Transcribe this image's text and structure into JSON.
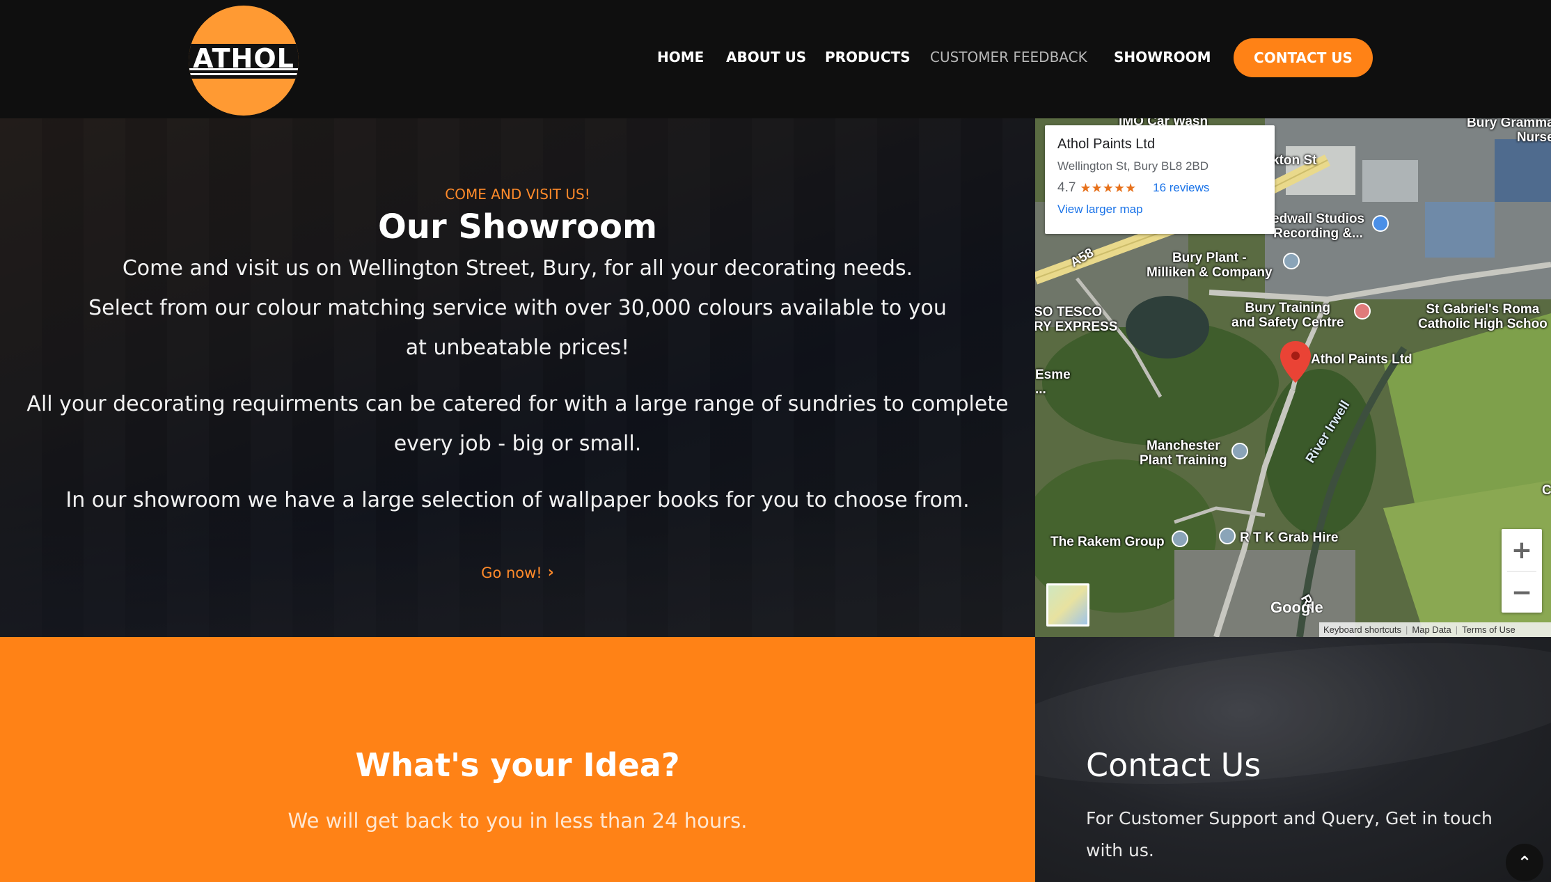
{
  "header": {
    "logo_text": "ATHOL",
    "nav": [
      {
        "label": "HOME"
      },
      {
        "label": "ABOUT US"
      },
      {
        "label": "PRODUCTS"
      },
      {
        "label": "CUSTOMER FEEDBACK"
      },
      {
        "label": "SHOWROOM"
      }
    ],
    "contact_button": "CONTACT US"
  },
  "showroom": {
    "eyebrow": "COME AND VISIT US!",
    "title": "Our Showroom",
    "paragraph_1_line_1": "Come and visit us on Wellington Street, Bury, for all your decorating needs.",
    "paragraph_1_line_2": "Select from our colour matching service with over 30,000 colours available to you at unbeatable prices!",
    "paragraph_2": "All your decorating requirments can be catered for with a large range of sundries to complete every job - big or small.",
    "paragraph_3": "In our showroom we have a large selection of wallpaper books for you to choose from.",
    "link": "Go now!"
  },
  "map": {
    "place_name": "Athol Paints Ltd",
    "address": "Wellington St, Bury BL8 2BD",
    "rating": "4.7",
    "stars": "★★★★★",
    "reviews": "16 reviews",
    "larger_map": "View larger map",
    "labels": {
      "car_wash": "IMO Car Wash",
      "bury_grammar": "Bury Gramma\nNurse",
      "street": "kton St",
      "studios": "edwall Studios\nRecording &...",
      "a58": "A58",
      "bury_plant": "Bury Plant -\nMilliken & Company",
      "tesco": "SO TESCO\nRY EXPRESS",
      "training": "Bury Training\nand Safety Centre",
      "st_gabriel": "St Gabriel's Roma\nCatholic High Schoo",
      "athol": "Athol Paints Ltd",
      "esme": "Esme\n...",
      "river": "River Irwell",
      "manchester": "Manchester\nPlant Training",
      "rakem": "The Rakem Group",
      "rtk": "R T K Grab Hire",
      "c": "C",
      "re": "Re"
    },
    "google": "Google",
    "attribution": [
      "Keyboard shortcuts",
      "Map Data",
      "Terms of Use"
    ],
    "zoom_in": "+",
    "zoom_out": "−"
  },
  "idea": {
    "title": "What's your Idea?",
    "subtitle": "We will get back to you in less than 24 hours."
  },
  "contact": {
    "title": "Contact Us",
    "text": "For Customer Support and Query, Get in touch with us.",
    "to_top": "⌃"
  },
  "colors": {
    "accent": "#ff8216",
    "header_bg": "#0f0f0f",
    "logo": "#ff9a33"
  }
}
